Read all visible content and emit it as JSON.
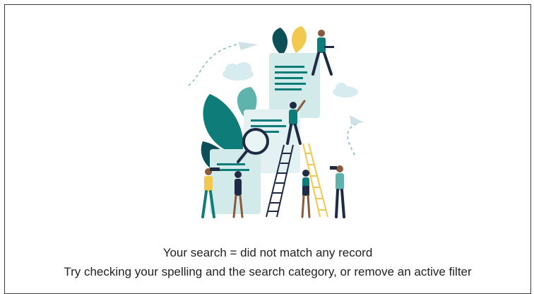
{
  "empty_state": {
    "illustration": "search-documents-illustration",
    "message": "Your search = did not match any record",
    "hint": "Try checking your spelling and the search category, or remove an active filter"
  },
  "colors": {
    "teal": "#0e7d7a",
    "dark_teal": "#0b4f57",
    "light_teal": "#cfe7e7",
    "yellow": "#f2c94c",
    "navy": "#1f2a44",
    "text": "#222222"
  }
}
